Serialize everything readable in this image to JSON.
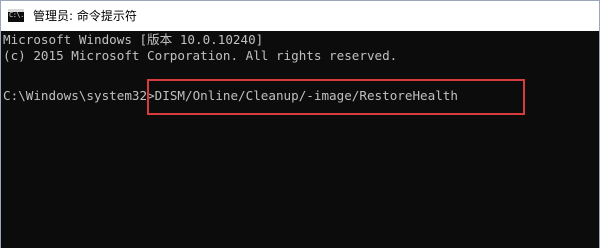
{
  "window": {
    "title": "管理员: 命令提示符",
    "icon": "cmd-icon",
    "icon_text": "C:\\."
  },
  "console": {
    "lines": [
      "Microsoft Windows [版本 10.0.10240]",
      "(c) 2015 Microsoft Corporation. All rights reserved."
    ],
    "prompt": "C:\\Windows\\system32>",
    "command": "DISM/Online/Cleanup/-image/RestoreHealth",
    "text_color": "#c0c0c0",
    "background_color": "#0c0c0c",
    "highlight_color": "#d83b3b"
  }
}
